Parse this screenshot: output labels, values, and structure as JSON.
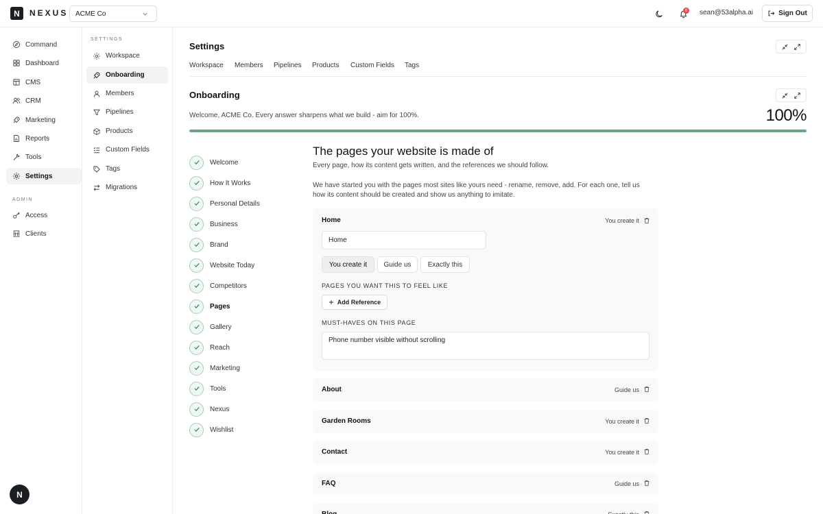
{
  "app": {
    "logo_letter": "N",
    "brand": "NEXUS",
    "workspace": "ACME Co",
    "notification_count": "6",
    "user_email": "sean@53alpha.ai",
    "sign_out_label": "Sign Out",
    "fab_letter": "N"
  },
  "sidebar": {
    "items": [
      {
        "label": "Command",
        "icon": "compass-icon"
      },
      {
        "label": "Dashboard",
        "icon": "grid-icon"
      },
      {
        "label": "CMS",
        "icon": "layout-icon"
      },
      {
        "label": "CRM",
        "icon": "users-icon"
      },
      {
        "label": "Marketing",
        "icon": "rocket-icon"
      },
      {
        "label": "Reports",
        "icon": "file-chart-icon"
      },
      {
        "label": "Tools",
        "icon": "wrench-icon"
      },
      {
        "label": "Settings",
        "icon": "gear-icon",
        "active": true
      }
    ],
    "admin_heading": "ADMIN",
    "admin_items": [
      {
        "label": "Access",
        "icon": "key-icon"
      },
      {
        "label": "Clients",
        "icon": "building-icon"
      }
    ]
  },
  "subnav": {
    "heading": "SETTINGS",
    "items": [
      {
        "label": "Workspace",
        "icon": "gear-icon"
      },
      {
        "label": "Onboarding",
        "icon": "rocket-icon",
        "active": true
      },
      {
        "label": "Members",
        "icon": "user-icon"
      },
      {
        "label": "Pipelines",
        "icon": "filter-icon"
      },
      {
        "label": "Products",
        "icon": "box-icon"
      },
      {
        "label": "Custom Fields",
        "icon": "list-icon"
      },
      {
        "label": "Tags",
        "icon": "tag-icon"
      },
      {
        "label": "Migrations",
        "icon": "arrows-icon"
      }
    ]
  },
  "main": {
    "title": "Settings",
    "tabs": [
      "Workspace",
      "Members",
      "Pipelines",
      "Products",
      "Custom Fields",
      "Tags"
    ],
    "section_title": "Onboarding",
    "welcome": "Welcome, ACME Co. Every answer sharpens what we build - aim for 100%.",
    "percent": "100%",
    "progress_fraction": 1.0,
    "steps": [
      "Welcome",
      "How It Works",
      "Personal Details",
      "Business",
      "Brand",
      "Website Today",
      "Competitors",
      "Pages",
      "Gallery",
      "Reach",
      "Marketing",
      "Tools",
      "Nexus",
      "Wishlist"
    ],
    "current_step": "Pages",
    "content": {
      "title": "The pages your website is made of",
      "p1": "Every page, how its content gets written, and the references we should follow.",
      "p2_line1": "We have started you with the pages most sites like yours need - rename, remove, add. For each one, tell us",
      "p2_line2": "how its content should be created and show us anything to imitate."
    },
    "expanded_page": {
      "name": "Home",
      "mode": "You create it",
      "name_value": "Home",
      "options": [
        "You create it",
        "Guide us",
        "Exactly this"
      ],
      "selected_option": "You create it",
      "references_label": "PAGES YOU WANT THIS TO FEEL LIKE",
      "add_reference_label": "Add Reference",
      "must_haves_label": "MUST-HAVES ON THIS PAGE",
      "must_haves_value": "Phone number visible without scrolling"
    },
    "pages": [
      {
        "name": "About",
        "mode": "Guide us"
      },
      {
        "name": "Garden Rooms",
        "mode": "You create it"
      },
      {
        "name": "Contact",
        "mode": "You create it"
      },
      {
        "name": "FAQ",
        "mode": "Guide us"
      },
      {
        "name": "Blog",
        "mode": "Exactly this"
      }
    ]
  }
}
